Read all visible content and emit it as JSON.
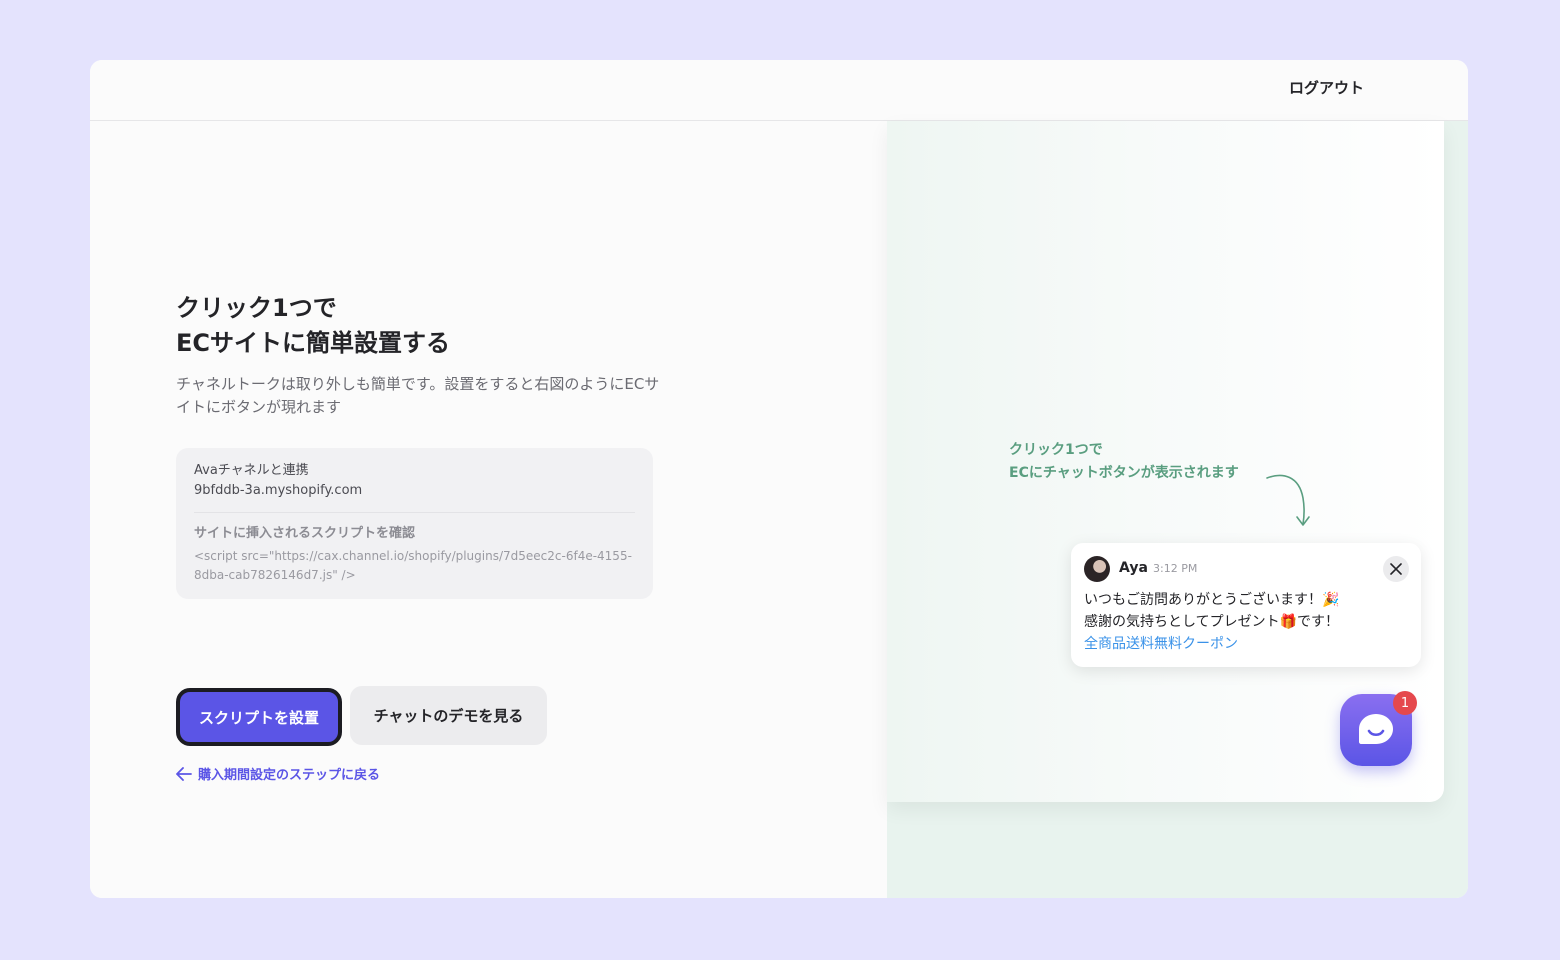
{
  "header": {
    "logout_label": "ログアウト"
  },
  "main": {
    "title_line1": "クリック1つで",
    "title_line2": "ECサイトに簡単設置する",
    "description": "チャネルトークは取り外しも簡単です。設置をすると右図のようにECサイトにボタンが現れます",
    "info": {
      "channel_label": "Avaチャネルと連携",
      "shop_domain": "9bfddb-3a.myshopify.com",
      "script_label": "サイトに挿入されるスクリプトを確認",
      "script_value": "<script src=\"https://cax.channel.io/shopify/plugins/7d5eec2c-6f4e-4155-8dba-cab7826146d7.js\" />"
    },
    "install_button": "スクリプトを設置",
    "demo_button": "チャットのデモを見る",
    "back_link": "購入期間設定のステップに戻る"
  },
  "preview": {
    "annotation_line1": "クリック1つで",
    "annotation_line2": "ECにチャットボタンが表示されます",
    "popup": {
      "sender": "Aya",
      "time": "3:12 PM",
      "message_line1": "いつもご訪問ありがとうございます！🎉",
      "message_line2": "感謝の気持ちとしてプレゼント🎁です！",
      "link_text": "全商品送料無料クーポン"
    },
    "badge_count": "1"
  },
  "colors": {
    "accent": "#5b55e6",
    "annotation": "#5a9e80",
    "link": "#3a92e8",
    "badge": "#e5484d",
    "background": "#e4e3fd"
  }
}
